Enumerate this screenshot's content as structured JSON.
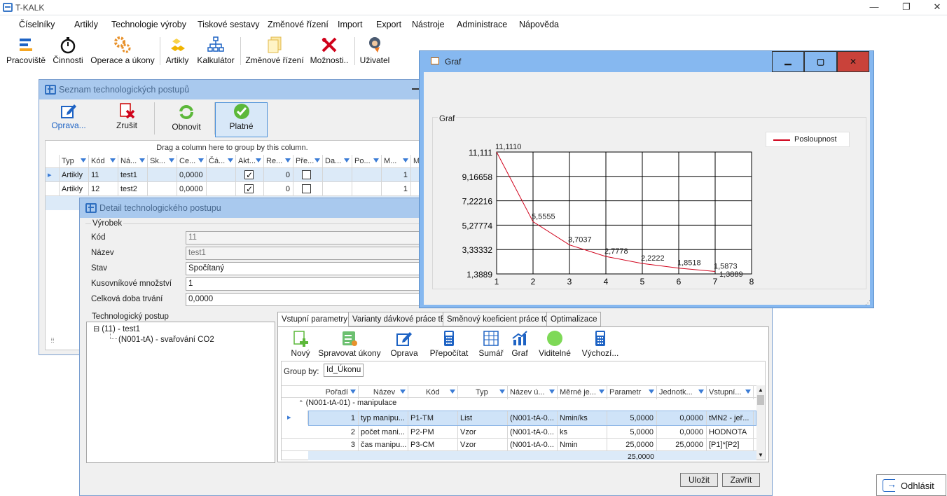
{
  "app": {
    "title": "T-KALK",
    "window_controls": [
      "—",
      "❐",
      "✕"
    ]
  },
  "menu": [
    "Číselníky",
    "Artikly",
    "Technologie výroby",
    "Tiskové sestavy",
    "Změnové řízení",
    "Import",
    "Export",
    "Nástroje",
    "Administrace",
    "Nápověda"
  ],
  "toolbar": {
    "pracoviste": "Pracoviště",
    "cinnosti": "Činnosti",
    "operace": "Operace a úkony",
    "artikly": "Artikly",
    "kalkulator": "Kalkulátor",
    "zmenove": "Změnové řízení",
    "moznosti": "Možnosti..",
    "uzivatel": "Uživatel"
  },
  "seznam": {
    "title": "Seznam technologických postupů",
    "buttons": {
      "oprava": "Oprava...",
      "zrusit": "Zrušit",
      "obnovit": "Obnovit",
      "platne": "Platné"
    },
    "group_hint": "Drag a column here to group by this column.",
    "columns": [
      "Typ",
      "Kód",
      "Ná...",
      "Sk...",
      "Ce...",
      "Čá...",
      "Akt...",
      "Re...",
      "Pře...",
      "Da...",
      "Po...",
      "M...",
      "M"
    ],
    "rows": [
      {
        "typ": "Artikly",
        "kod": "11",
        "nazev": "test1",
        "cena": "0,0000",
        "aktivni": true,
        "re": "0",
        "pre": false,
        "m": "1"
      },
      {
        "typ": "Artikly",
        "kod": "12",
        "nazev": "test2",
        "cena": "0,0000",
        "aktivni": true,
        "re": "0",
        "pre": false,
        "m": "1"
      }
    ]
  },
  "detail": {
    "title": "Detail technologického postupu",
    "vyrobek_label": "Výrobek",
    "fields": [
      {
        "label": "Kód",
        "value": "11"
      },
      {
        "label": "Název",
        "value": "test1"
      },
      {
        "label": "Stav",
        "value": "Spočítaný"
      },
      {
        "label": "Kusovníkové množství",
        "value": "1"
      },
      {
        "label": "Celková doba trvání",
        "value": "0,0000"
      }
    ],
    "tree": {
      "label": "Technologický postup",
      "root": "(11) - test1",
      "child": "(N001-tA) - svařování CO2",
      "expander": "⊟"
    },
    "tabs": [
      "Vstupní parametry",
      "Varianty dávkové práce tB",
      "Směnový koeficient práce tC",
      "Optimalizace"
    ],
    "tab_buttons": [
      "Nový",
      "Spravovat úkony",
      "Oprava",
      "Přepočítat",
      "Sumář",
      "Graf",
      "Viditelné",
      "Výchozí..."
    ],
    "group_by_label": "Group by:",
    "group_by_value": "Id_Úkonu",
    "columns": [
      "Pořadí",
      "Název",
      "Kód",
      "Typ",
      "Název ú...",
      "Měrné je...",
      "Parametr",
      "Jednotk...",
      "Vstupní..."
    ],
    "group_row": "(N001-tA-01) - manipulace",
    "rows": [
      [
        "1",
        "typ manipu...",
        "P1-TM",
        "List",
        "(N001-tA-0...",
        "Nmin/ks",
        "5,0000",
        "0,0000",
        "tMN2 - jeř..."
      ],
      [
        "2",
        "počet mani...",
        "P2-PM",
        "Vzor",
        "(N001-tA-0...",
        "ks",
        "5,0000",
        "0,0000",
        "HODNOTA"
      ],
      [
        "3",
        "čas manipu...",
        "P3-CM",
        "Vzor",
        "(N001-tA-0...",
        "Nmin",
        "25,0000",
        "25,0000",
        "[P1]*[P2]"
      ]
    ],
    "summary": "25,0000",
    "ulozit": "Uložit",
    "zavrit": "Zavřít"
  },
  "graf": {
    "title": "Graf",
    "controls": [
      "▁",
      "▢",
      "✕"
    ]
  },
  "chart_data": {
    "type": "line",
    "title": "Graf",
    "legend": "top-right",
    "series": [
      {
        "name": "Posloupnost",
        "color": "#d0021b",
        "x": [
          1,
          2,
          3,
          4,
          5,
          6,
          7
        ],
        "values": [
          11.111,
          5.5555,
          3.7037,
          2.7778,
          2.2222,
          1.8518,
          1.5873
        ]
      }
    ],
    "labels": [
      "11,1110",
      "5,5555",
      "3,7037",
      "2,7778",
      "2,2222",
      "1,8518",
      "1,5873"
    ],
    "extra_label": "1,3889",
    "xticks": [
      "1",
      "2",
      "3",
      "4",
      "5",
      "6",
      "7",
      "8"
    ],
    "yticks": [
      "1,3889",
      "3,33332",
      "5,27774",
      "7,22216",
      "9,16658",
      "11,111"
    ],
    "xlim": [
      1,
      8
    ],
    "ylim": [
      1.3889,
      11.111
    ],
    "grid": true
  },
  "odhlasit": "Odhlásit"
}
